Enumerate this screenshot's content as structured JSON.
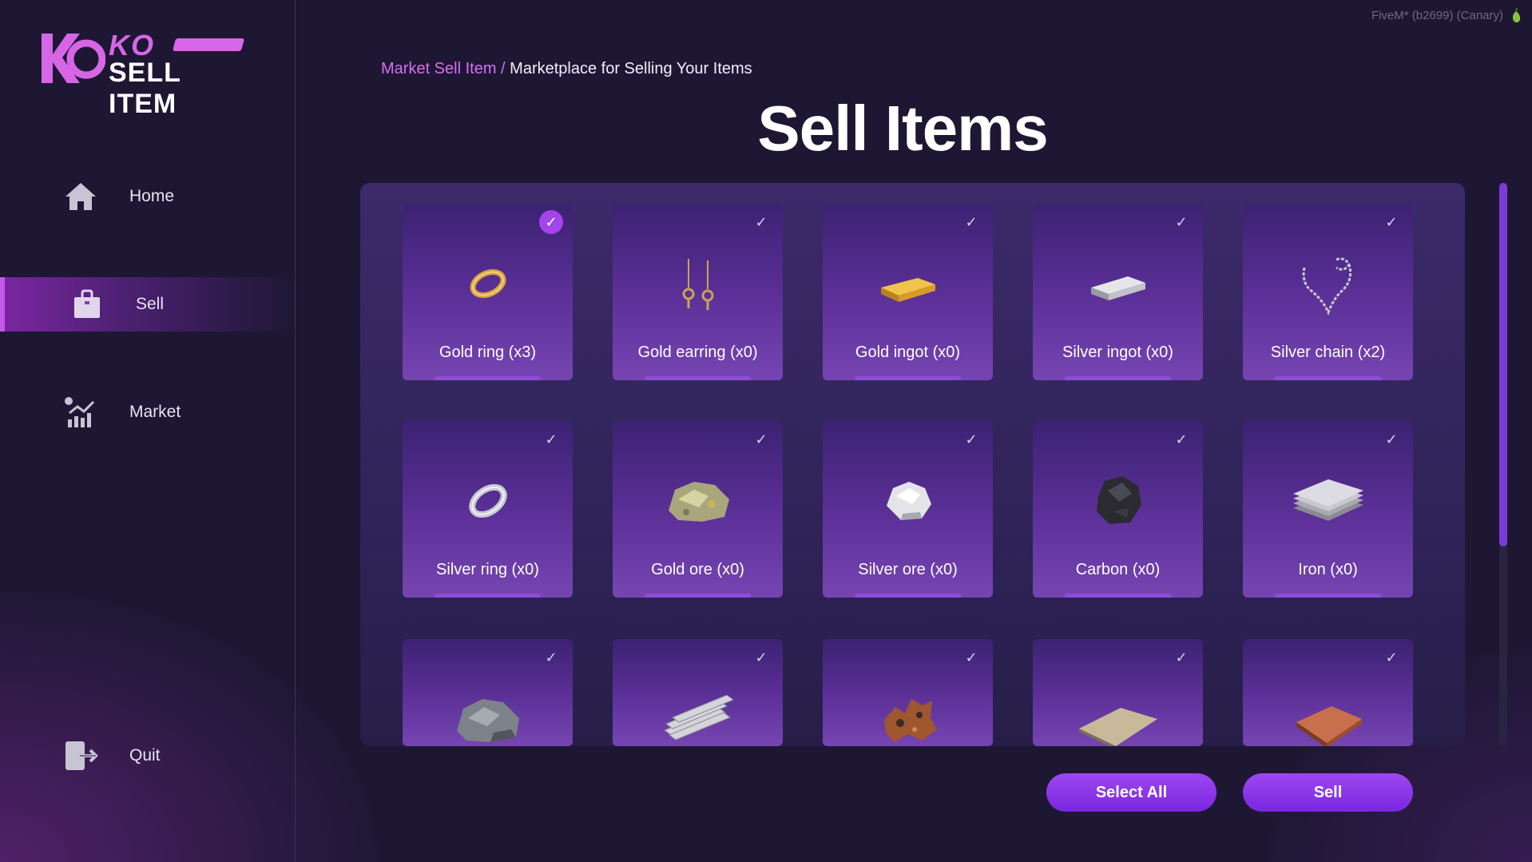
{
  "app": {
    "logo_top": "KO",
    "logo_bottom": "SELL ITEM",
    "build_info": "FiveM* (b2699) (Canary)"
  },
  "sidebar": {
    "items": [
      {
        "label": "Home",
        "icon": "home-icon"
      },
      {
        "label": "Sell",
        "icon": "shopping-bag-icon",
        "active": true
      },
      {
        "label": "Market",
        "icon": "market-chart-icon"
      },
      {
        "label": "Quit",
        "icon": "exit-icon"
      }
    ]
  },
  "header": {
    "breadcrumb_link": "Market Sell Item /",
    "breadcrumb_current": "Marketplace for Selling Your Items",
    "title": "Sell Items"
  },
  "items": [
    {
      "name": "Gold ring (x3)",
      "selected": true,
      "icon": "gold-ring"
    },
    {
      "name": "Gold earring (x0)",
      "selected": false,
      "icon": "gold-earring"
    },
    {
      "name": "Gold ingot (x0)",
      "selected": false,
      "icon": "gold-ingot"
    },
    {
      "name": "Silver ingot (x0)",
      "selected": false,
      "icon": "silver-ingot"
    },
    {
      "name": "Silver chain (x2)",
      "selected": false,
      "icon": "silver-chain"
    },
    {
      "name": "Silver ring (x0)",
      "selected": false,
      "icon": "silver-ring"
    },
    {
      "name": "Gold ore (x0)",
      "selected": false,
      "icon": "gold-ore"
    },
    {
      "name": "Silver ore (x0)",
      "selected": false,
      "icon": "silver-ore"
    },
    {
      "name": "Carbon (x0)",
      "selected": false,
      "icon": "carbon"
    },
    {
      "name": "Iron (x0)",
      "selected": false,
      "icon": "iron-sheets"
    },
    {
      "name": "",
      "selected": false,
      "icon": "rock-ore"
    },
    {
      "name": "",
      "selected": false,
      "icon": "steel-bars"
    },
    {
      "name": "",
      "selected": false,
      "icon": "copper-ore"
    },
    {
      "name": "",
      "selected": false,
      "icon": "aluminum-sheet"
    },
    {
      "name": "",
      "selected": false,
      "icon": "copper-sheet"
    }
  ],
  "actions": {
    "select_all": "Select All",
    "sell": "Sell"
  },
  "colors": {
    "accent": "#a444ea",
    "breadcrumb_link": "#d86ef0",
    "background": "#1d1733"
  }
}
